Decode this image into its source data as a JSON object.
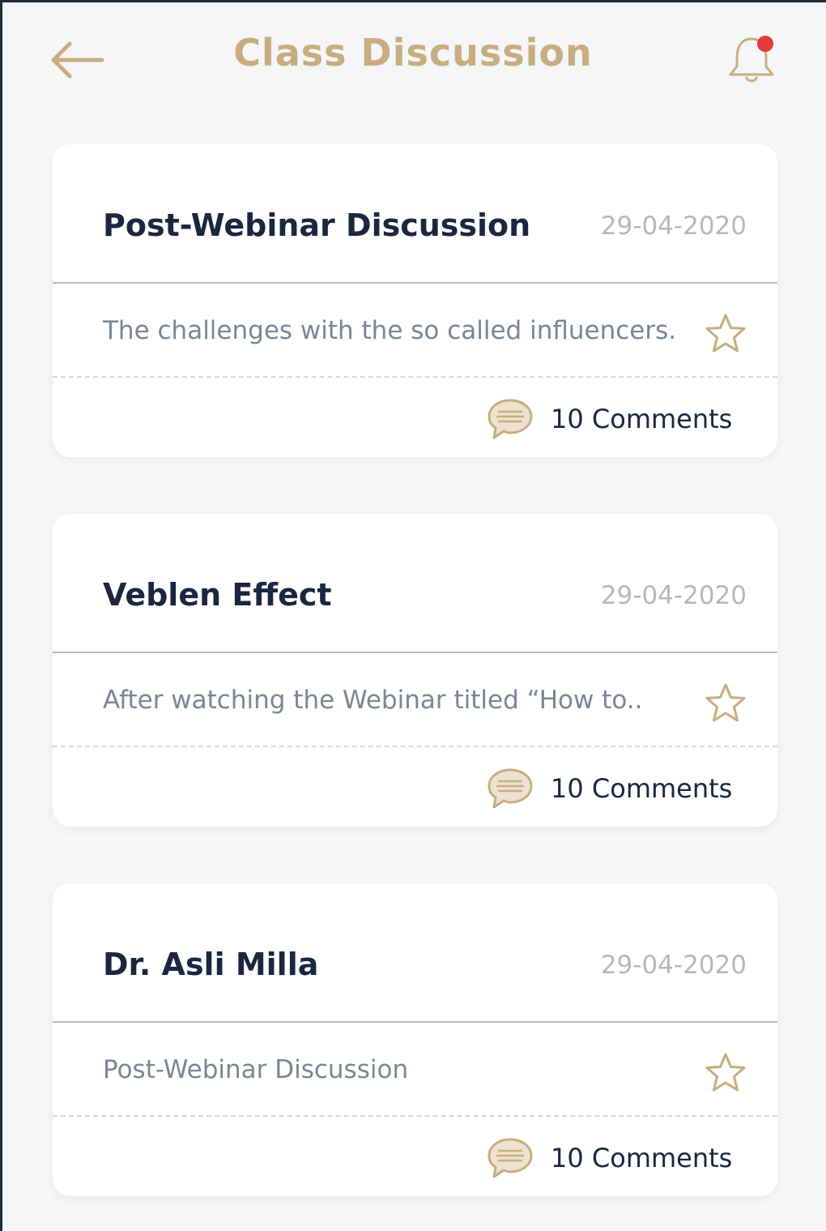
{
  "header": {
    "title": "Class Discussion",
    "back_icon": "arrow-left-icon",
    "notification_icon": "bell-icon",
    "has_unread_notification": true
  },
  "colors": {
    "accent_gold": "#c8ad7f",
    "title_navy": "#1a2740",
    "date_gray": "#b4b8bd",
    "description_gray": "#7a8696",
    "notification_dot": "#e03a3a",
    "background": "#f4f6f7"
  },
  "discussions": [
    {
      "title": "Post-Webinar Discussion",
      "date": "29-04-2020",
      "description": "The challenges with the so called influencers.",
      "comments_label": "10 Comments",
      "starred": false
    },
    {
      "title": "Veblen Effect",
      "date": "29-04-2020",
      "description": "After watching the Webinar titled “How to..",
      "comments_label": "10 Comments",
      "starred": false
    },
    {
      "title": "Dr. Asli Milla",
      "date": "29-04-2020",
      "description": "Post-Webinar Discussion",
      "comments_label": "10 Comments",
      "starred": false
    }
  ]
}
